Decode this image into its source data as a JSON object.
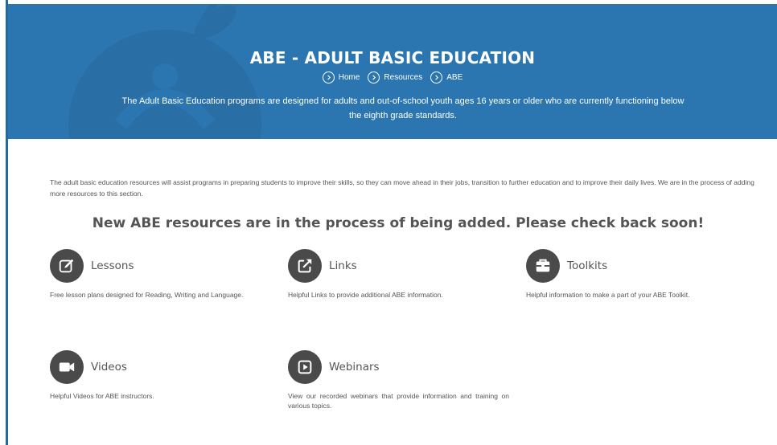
{
  "hero": {
    "title": "ABE - ADULT BASIC EDUCATION",
    "breadcrumbs": [
      {
        "label": "Home"
      },
      {
        "label": "Resources"
      },
      {
        "label": "ABE"
      }
    ],
    "description": "The Adult Basic Education programs are designed for adults and out-of-school youth ages 16 years or older who are currently functioning below the eighth grade standards."
  },
  "main": {
    "intro": "The adult basic education resources will assist programs in preparing students to improve their skills, so they can move ahead in their jobs, transition to further education and to improve their daily lives. We are in the process of adding more resources to this section.",
    "notice": "New ABE resources are in the process of being added. Please check back soon!",
    "resources": [
      {
        "title": "Lessons",
        "icon": "edit-icon",
        "description": "Free lesson plans designed for Reading, Writing and Language."
      },
      {
        "title": "Links",
        "icon": "external-link-icon",
        "description": "Helpful Links to provide additional ABE information."
      },
      {
        "title": "Toolkits",
        "icon": "briefcase-icon",
        "description": "Helpful information to make a part of your ABE Toolkit."
      },
      {
        "title": "Videos",
        "icon": "video-camera-icon",
        "description": "Helpful Videos for ABE instructors."
      },
      {
        "title": "Webinars",
        "icon": "play-square-icon",
        "description": "View our recorded webinars that provide information and training on various topics."
      }
    ]
  },
  "colors": {
    "hero_background": "#2b76b1",
    "icon_circle": "#4a4a4a",
    "text": "#555555"
  }
}
